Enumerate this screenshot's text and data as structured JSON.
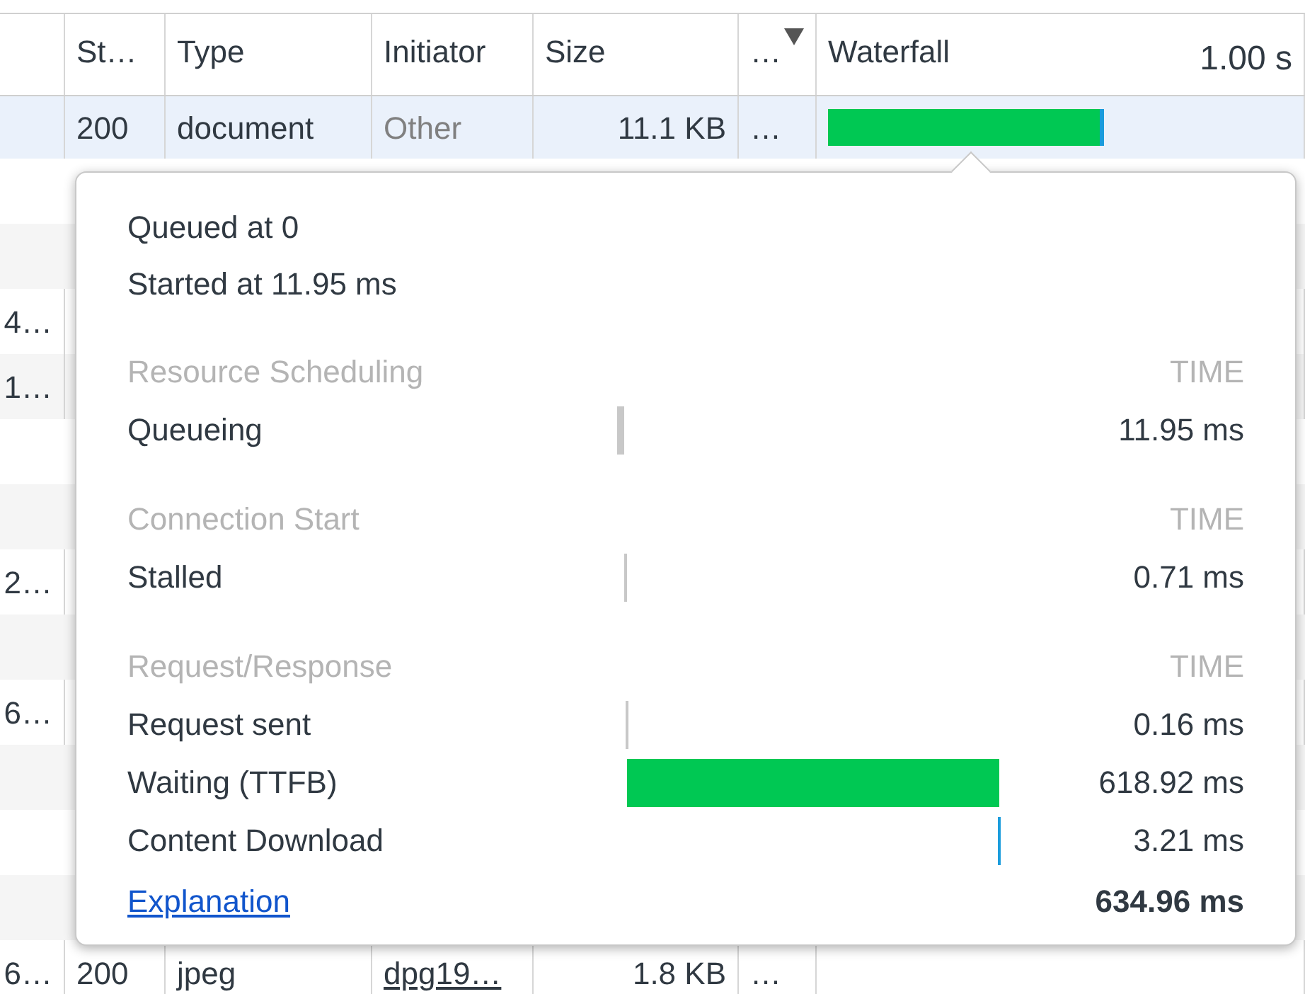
{
  "table": {
    "columns": [
      {
        "label": "St…",
        "sorted": false
      },
      {
        "label": "Type",
        "sorted": false
      },
      {
        "label": "Initiator",
        "sorted": false
      },
      {
        "label": "Size",
        "sorted": false
      },
      {
        "label": "…",
        "sorted": true
      },
      {
        "label": "Waterfall",
        "sorted": false
      }
    ],
    "time_scale": "1.00 s",
    "rows": [
      {
        "selected": true,
        "status": "200",
        "type": "document",
        "initiator": {
          "text": "Other",
          "kind": "other"
        },
        "size": "11.1 KB",
        "more": "…",
        "waterfall": true
      },
      {
        "name": "4…"
      },
      {
        "name": "1…"
      },
      {
        "name": "2…"
      },
      {
        "name": "6…"
      },
      {
        "selected": false,
        "name": "6…",
        "status": "200",
        "type": "jpeg",
        "initiator": {
          "text": "dpg19…",
          "kind": "link"
        },
        "size": "1.8 KB",
        "more": "…"
      }
    ]
  },
  "timing": {
    "lines": [
      "Queued at 0",
      "Started at 11.95 ms"
    ],
    "sections": [
      {
        "title": "Resource Scheduling",
        "time_label": "TIME",
        "rows": [
          {
            "label": "Queueing",
            "value": "11.95 ms",
            "color": "#c8c8c8"
          }
        ]
      },
      {
        "title": "Connection Start",
        "time_label": "TIME",
        "rows": [
          {
            "label": "Stalled",
            "value": "0.71 ms",
            "color": "#c8c8c8"
          }
        ]
      },
      {
        "title": "Request/Response",
        "time_label": "TIME",
        "rows": [
          {
            "label": "Request sent",
            "value": "0.16 ms",
            "color": "#c8c8c8"
          },
          {
            "label": "Waiting (TTFB)",
            "value": "618.92 ms",
            "color": "#00c853"
          },
          {
            "label": "Content Download",
            "value": "3.21 ms",
            "color": "#1a9cdc"
          }
        ]
      }
    ],
    "explanation": "Explanation",
    "total": "634.96 ms"
  }
}
